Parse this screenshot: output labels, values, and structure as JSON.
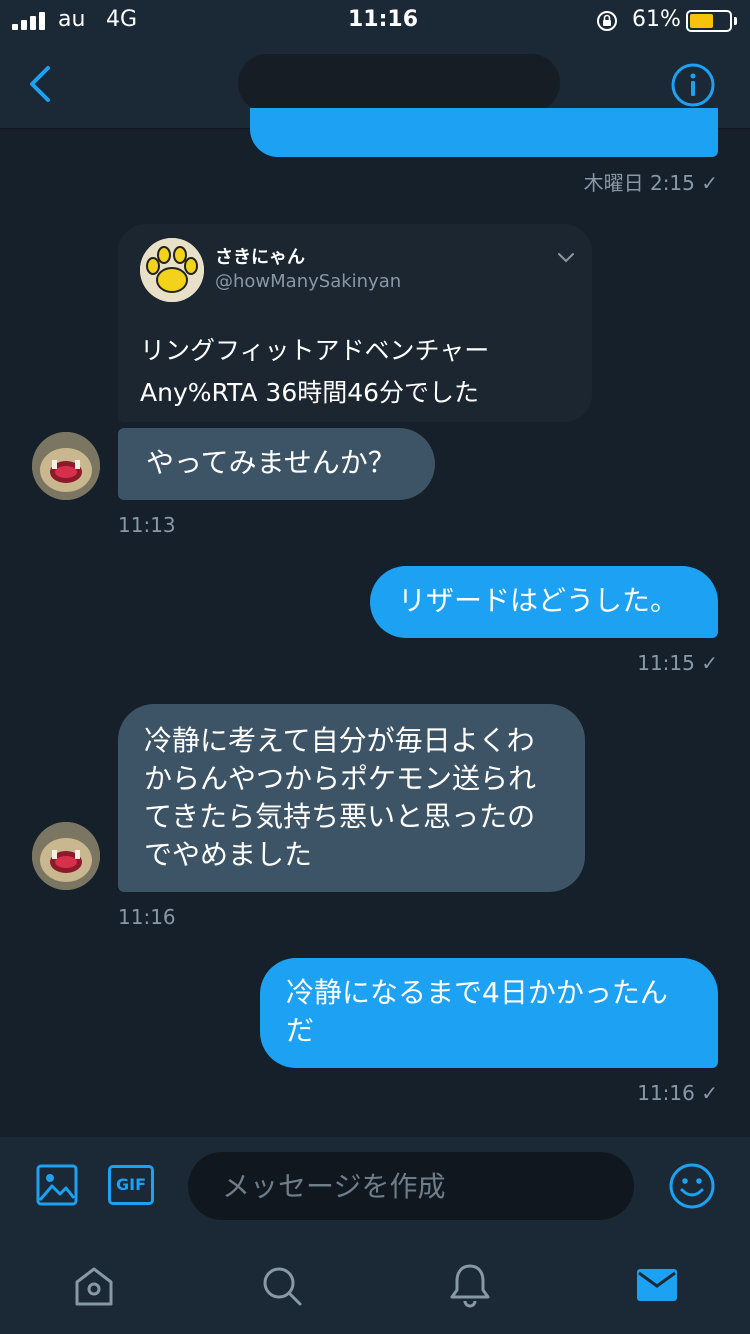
{
  "status_bar": {
    "carrier": "au",
    "network": "4G",
    "time": "11:16",
    "battery": "61%",
    "battery_level": 0.61,
    "battery_color": "#f6c30a"
  },
  "header": {
    "title": "",
    "accent": "#1da1f2"
  },
  "messages": {
    "m1_time": "木曜日 2:15 ✓",
    "quoted_tweet": {
      "name": "さきにゃん",
      "handle": "@howManySakinyan",
      "text_line1": "リングフィットアドベンチャー",
      "text_line2": "Any%RTA 36時間46分でした"
    },
    "m2_text": "やってみませんか？",
    "m2_time": "11:13",
    "m3_text": "リザードはどうした。",
    "m3_time": "11:15 ✓",
    "m4_line1": "冷静に考えて自分が毎日よくわ",
    "m4_line2": "からんやつからポケモン送られ",
    "m4_line3": "てきたら気持ち悪いと思ったの",
    "m4_line4": "でやめました",
    "m4_time": "11:16",
    "m5_line1": "冷静になるまで4日かかったん",
    "m5_line2": "だ",
    "m5_time": "11:16 ✓"
  },
  "composer": {
    "placeholder": "メッセージを作成",
    "gif_label": "GIF"
  },
  "colors": {
    "background": "#15202b",
    "bar": "#1b2836",
    "sent_bubble": "#1da1f2",
    "received_bubble": "#3d5466",
    "timestamp": "#8899a6"
  }
}
